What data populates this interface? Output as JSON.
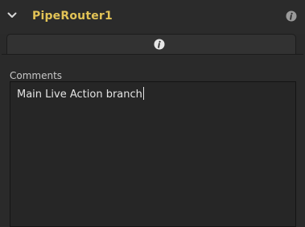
{
  "header": {
    "title": "PipeRouter1",
    "collapse_icon": "chevron-down-icon",
    "info_icon": "info-icon"
  },
  "tabs": [
    {
      "icon": "info-icon",
      "selected": true
    }
  ],
  "comments": {
    "label": "Comments",
    "value": "Main Live Action branch"
  },
  "colors": {
    "title": "#e2c356",
    "background": "#2b2b2b",
    "text": "#e4e4e4"
  }
}
